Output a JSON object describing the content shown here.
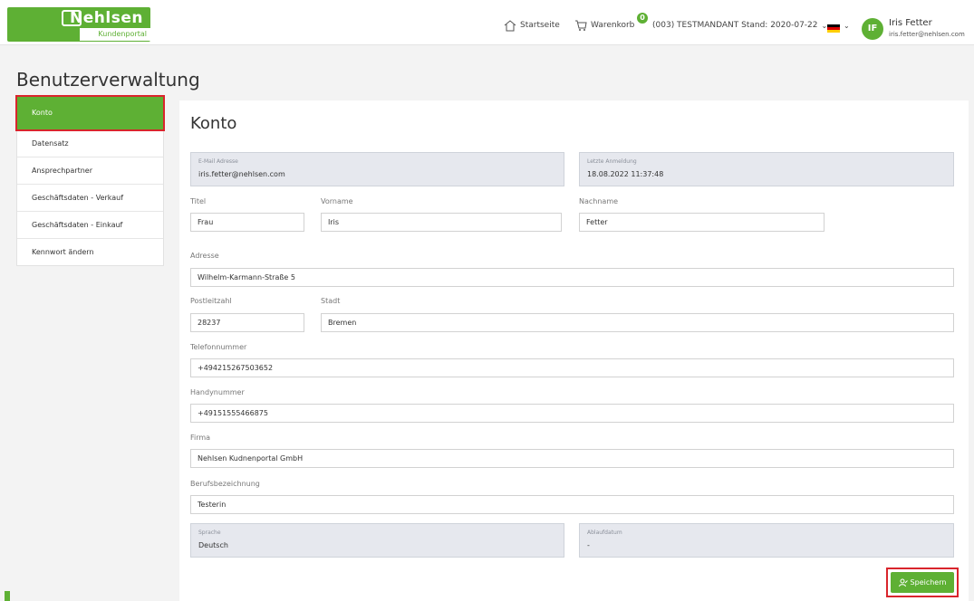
{
  "brand": {
    "name": "Nehlsen",
    "subtitle": "Kundenportal",
    "color": "#5eb034"
  },
  "header": {
    "home_label": "Startseite",
    "cart_label": "Warenkorb",
    "cart_count": "0",
    "tenant": "(003) TESTMANDANT Stand: 2020-07-22",
    "language_flag": "de-flag-icon",
    "user": {
      "initials": "IF",
      "name": "Iris Fetter",
      "email": "iris.fetter@nehlsen.com"
    }
  },
  "page": {
    "title": "Benutzerverwaltung"
  },
  "sidebar": {
    "items": [
      {
        "label": "Konto",
        "active": true
      },
      {
        "label": "Datensatz"
      },
      {
        "label": "Ansprechpartner"
      },
      {
        "label": "Geschäftsdaten - Verkauf"
      },
      {
        "label": "Geschäftsdaten - Einkauf"
      },
      {
        "label": "Kennwort ändern"
      }
    ]
  },
  "form": {
    "title": "Konto",
    "email": {
      "label": "E-Mail Adresse",
      "value": "iris.fetter@nehlsen.com"
    },
    "last_login": {
      "label": "Letzte Anmeldung",
      "value": "18.08.2022 11:37:48"
    },
    "titel": {
      "label": "Titel",
      "value": "Frau"
    },
    "vorname": {
      "label": "Vorname",
      "value": "Iris"
    },
    "nachname": {
      "label": "Nachname",
      "value": "Fetter"
    },
    "adresse": {
      "label": "Adresse",
      "value": "Wilhelm-Karmann-Straße 5"
    },
    "plz": {
      "label": "Postleitzahl",
      "value": "28237"
    },
    "stadt": {
      "label": "Stadt",
      "value": "Bremen"
    },
    "telefon": {
      "label": "Telefonnummer",
      "value": "+494215267503652"
    },
    "handy": {
      "label": "Handynummer",
      "value": "+49151555466875"
    },
    "firma": {
      "label": "Firma",
      "value": "Nehlsen Kudnenportal GmbH"
    },
    "beruf": {
      "label": "Berufsbezeichnung",
      "value": "Testerin"
    },
    "sprache": {
      "label": "Sprache",
      "value": "Deutsch"
    },
    "ablauf": {
      "label": "Ablaufdatum",
      "value": "-"
    },
    "save_label": "Speichern"
  },
  "colors": {
    "accent": "#5eb034",
    "highlight": "#d9252c",
    "readonly_bg": "#e6e8ee"
  }
}
